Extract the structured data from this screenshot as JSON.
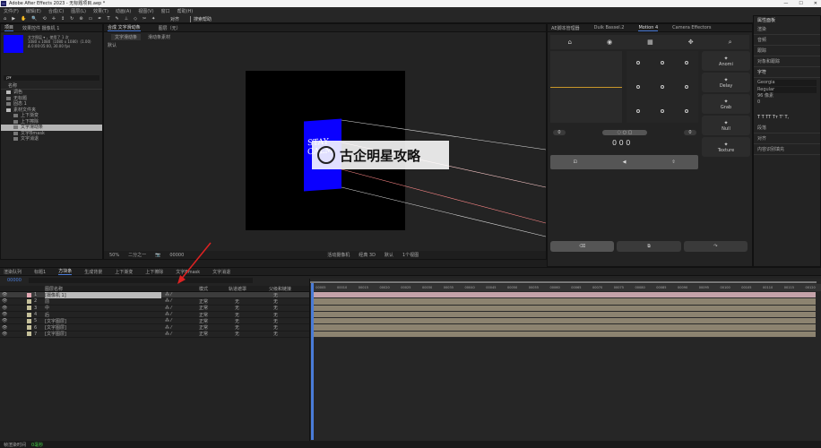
{
  "window": {
    "title": "Adobe After Effects 2023 - 无标题项目.aep *",
    "logo": "Ae",
    "controls": [
      "—",
      "☐",
      "✕"
    ]
  },
  "menu": [
    "文件(F)",
    "编辑(E)",
    "合成(C)",
    "图层(L)",
    "效果(T)",
    "动画(A)",
    "视图(V)",
    "窗口",
    "帮助(H)"
  ],
  "toolbar": {
    "icons": [
      "home-icon",
      "selection-icon",
      "hand-icon",
      "zoom-icon",
      "orbit-icon",
      "pan-icon",
      "dolly-icon",
      "rotate-icon",
      "pan-behind-icon",
      "rectangle-icon",
      "pen-icon",
      "type-icon",
      "brush-icon",
      "clone-icon",
      "eraser-icon",
      "roto-icon",
      "pin-icon"
    ],
    "glyphs": [
      "⌂",
      "▶",
      "✋",
      "🔍",
      "⟲",
      "✛",
      "↕",
      "↻",
      "⊛",
      "▭",
      "✒",
      "T",
      "✎",
      "⊥",
      "◇",
      "✂",
      "✦"
    ],
    "snap_label": "对齐",
    "search_label": "搜索帮助"
  },
  "project": {
    "tab": "项目",
    "tab2": "效果控件 摄像机 1",
    "thumb_color": "#0a00ff",
    "info": [
      "文字图层 ▾ ，使用了 1 次",
      "1080 x 1080（1080 x 1080）(1.00)",
      "Δ 0:00:05:00, 30.00 fps"
    ],
    "search_placeholder": "ρ▾",
    "column": "名称",
    "items": [
      {
        "name": "调色",
        "type": "folder",
        "indent": 0
      },
      {
        "name": "无标题",
        "type": "comp",
        "indent": 0
      },
      {
        "name": "固态 1",
        "type": "comp",
        "indent": 0
      },
      {
        "name": "素材文件夹",
        "type": "folder",
        "indent": 0
      },
      {
        "name": "上下渐变",
        "type": "comp",
        "indent": 1
      },
      {
        "name": "上下擦除",
        "type": "comp",
        "indent": 1
      },
      {
        "name": "文字滑动条",
        "type": "comp",
        "indent": 1,
        "selected": true
      },
      {
        "name": "文字Bmask",
        "type": "comp",
        "indent": 1
      },
      {
        "name": "文字消退",
        "type": "comp",
        "indent": 1
      }
    ]
  },
  "viewer": {
    "tab": "合成 文字滑动条",
    "tab_layer": "图层（无）",
    "sub_tabs": [
      "文字滑动条",
      "滑动条素材"
    ],
    "camera_label": "默认",
    "canvas_text": "STAY CALM",
    "watermark": "古企明星攻略",
    "zoom": "50%",
    "quality": "二分之一",
    "timecode": "00000",
    "camera_view": "活动摄像机",
    "views": "1个视图",
    "renderer": "经典 3D",
    "mode": "默认"
  },
  "motion": {
    "tabs": [
      "AE脚本管理器",
      "Duik Bassel.2",
      "Motion 4",
      "Camera Effectors"
    ],
    "active_tab": 2,
    "side_buttons": [
      "Anomi",
      "Delay",
      "Grab",
      "Null",
      "Texture"
    ],
    "counter": "0 0 0",
    "left_val": "0",
    "right_val": "0",
    "bar_color": "#c8962a"
  },
  "properties": {
    "title": "属性面板",
    "sections": [
      "渲染",
      "音频",
      "跟踪",
      "对象和跟踪",
      "字符",
      "段落",
      "对齐",
      "内容识别填充"
    ],
    "font": "Georgia",
    "style": "Regular",
    "size_label": "96 像素",
    "tracking": "0",
    "text_styles": "T T TT Tт T' T,"
  },
  "timeline": {
    "tabs": [
      "渲染队列",
      "标题1",
      "方块条",
      "生成背景",
      "上下渐变",
      "上下擦除",
      "文字Bmask",
      "文字消退"
    ],
    "active_tab": 2,
    "timecode": "00000",
    "col_headers": {
      "name": "图层名称",
      "mode": "模式",
      "matte": "轨道遮罩",
      "parent": "父级和链接"
    },
    "ruler": [
      "00005",
      "00010",
      "00015",
      "00020",
      "00025",
      "00030",
      "00035",
      "00040",
      "00045",
      "00050",
      "00055",
      "00060",
      "00065",
      "00070",
      "00075",
      "00080",
      "00085",
      "00090",
      "00095",
      "00100",
      "00105",
      "00110",
      "00115",
      "00120"
    ],
    "layers": [
      {
        "num": "1",
        "name": "[摄像机 1]",
        "color": "#e6a9b4",
        "mode": "",
        "matte": "",
        "parent": "无",
        "track": "#c4a2a9"
      },
      {
        "num": "2",
        "name": "前",
        "color": "#c5c09a",
        "mode": "正常",
        "matte": "无",
        "parent": "无",
        "track": "#8c8370"
      },
      {
        "num": "3",
        "name": "中",
        "color": "#c5c09a",
        "mode": "正常",
        "matte": "无",
        "parent": "无",
        "track": "#8c8370"
      },
      {
        "num": "4",
        "name": "后",
        "color": "#c5c09a",
        "mode": "正常",
        "matte": "无",
        "parent": "无",
        "track": "#8c8370"
      },
      {
        "num": "5",
        "name": "[文字图层]",
        "color": "#c5c09a",
        "mode": "正常",
        "matte": "无",
        "parent": "无",
        "track": "#8c8370"
      },
      {
        "num": "6",
        "name": "[文字图层]",
        "color": "#c5c09a",
        "mode": "正常",
        "matte": "无",
        "parent": "无",
        "track": "#8c8370"
      },
      {
        "num": "7",
        "name": "[文字图层]",
        "color": "#c5c09a",
        "mode": "正常",
        "matte": "无",
        "parent": "无",
        "track": "#8c8370"
      }
    ]
  },
  "status": {
    "text": "帧渲染时间",
    "value": "0毫秒"
  }
}
